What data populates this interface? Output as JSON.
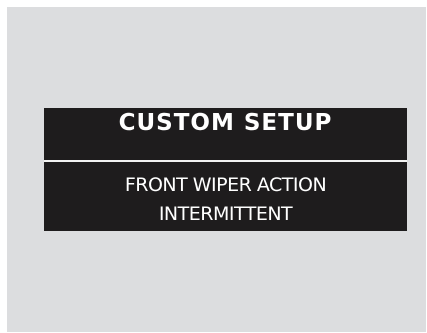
{
  "display": {
    "title": "CUSTOM SETUP",
    "setting_name": "FRONT WIPER ACTION",
    "setting_value": "INTERMITTENT"
  }
}
